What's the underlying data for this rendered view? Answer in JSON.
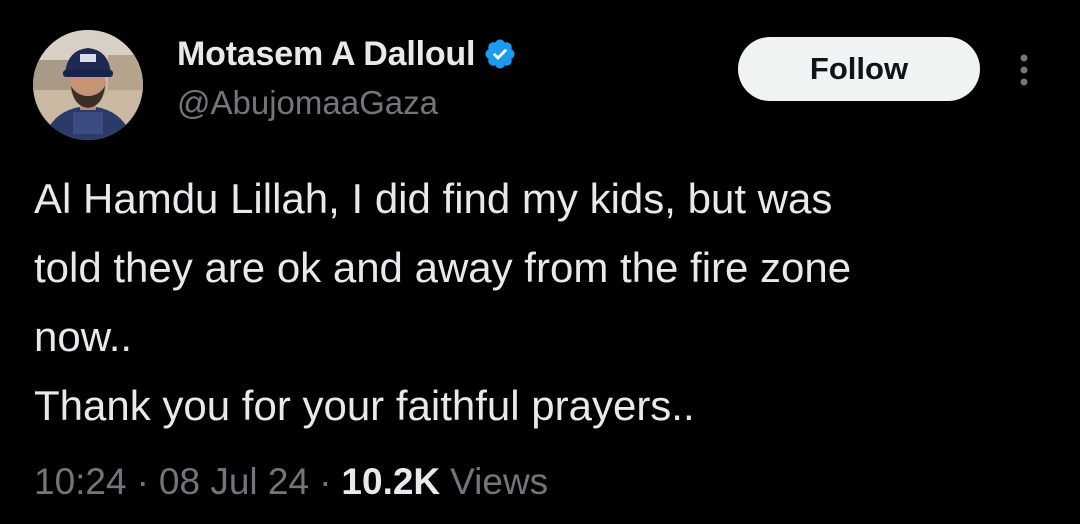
{
  "author": {
    "name": "Motasem A Dalloul",
    "handle": "@AbujomaaGaza",
    "verified_icon": "verified-badge-icon",
    "verified_color": "#1d9bf0"
  },
  "follow_button": {
    "label": "Follow"
  },
  "more_icon": "more-vertical-icon",
  "tweet": {
    "lines": [
      "Al Hamdu Lillah, I did find my kids, but was",
      "told they are ok and away from the fire zone",
      "now..",
      "Thank you for your faithful prayers.."
    ]
  },
  "meta": {
    "time": "10:24",
    "separator": "·",
    "date": "08 Jul 24",
    "views_count": "10.2K",
    "views_label": "Views"
  },
  "colors": {
    "background": "#000000",
    "primary_text": "#e7e9ea",
    "secondary_text": "#71767b",
    "button_bg": "#eff3f4"
  }
}
